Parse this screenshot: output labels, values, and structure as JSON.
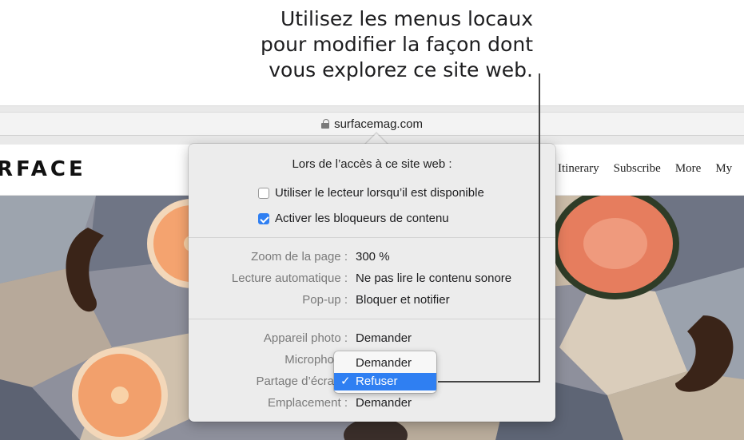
{
  "callout": {
    "lines": [
      "Utilisez les menus locaux",
      "pour modifier la façon dont",
      "vous explorez ce site web."
    ]
  },
  "browser": {
    "url": "surfacemag.com"
  },
  "site": {
    "brand": "RFACE",
    "nav": [
      "Itinerary",
      "Subscribe",
      "More",
      "My"
    ]
  },
  "popover": {
    "title": "Lors de l’accès à ce site web :",
    "checkboxes": [
      {
        "label": "Utiliser le lecteur lorsqu’il est disponible",
        "checked": false
      },
      {
        "label": "Activer les bloqueurs de contenu",
        "checked": true
      }
    ],
    "settings1": [
      {
        "label": "Zoom de la page :",
        "value": "300 %"
      },
      {
        "label": "Lecture automatique :",
        "value": "Ne pas lire le contenu sonore"
      },
      {
        "label": "Pop-up :",
        "value": "Bloquer et notifier"
      }
    ],
    "settings2": [
      {
        "label": "Appareil photo :",
        "value": "Demander"
      },
      {
        "label": "Micropho",
        "value": ""
      },
      {
        "label": "Partage d’écra",
        "value": ""
      },
      {
        "label": "Emplacement :",
        "value": "Demander"
      }
    ]
  },
  "dropdown": {
    "options": [
      {
        "label": "Demander",
        "selected": false
      },
      {
        "label": "Refuser",
        "selected": true
      }
    ],
    "check_mark": "✓"
  },
  "colors": {
    "accent": "#2f7ff2",
    "popover_bg": "#ececec",
    "label_gray": "#7a7a7a"
  }
}
